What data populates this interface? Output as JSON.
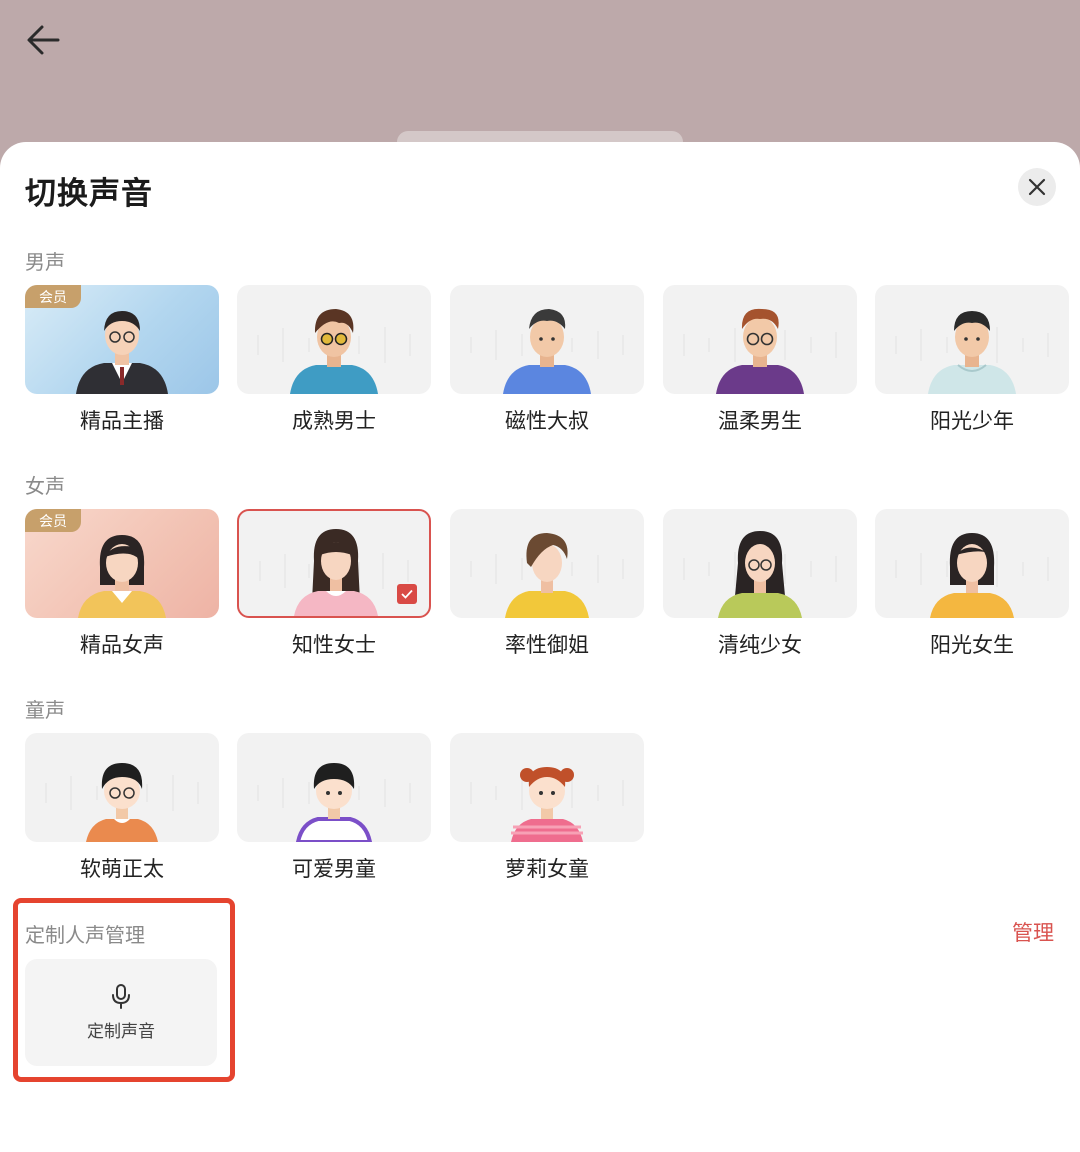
{
  "header": {
    "back_icon": "back-arrow-icon"
  },
  "sheet": {
    "title": "切换声音",
    "close_icon": "close-icon",
    "sections": {
      "male": {
        "label": "男声",
        "items": [
          {
            "label": "精品主播",
            "vip": "会员"
          },
          {
            "label": "成熟男士"
          },
          {
            "label": "磁性大叔"
          },
          {
            "label": "温柔男生"
          },
          {
            "label": "阳光少年"
          }
        ]
      },
      "female": {
        "label": "女声",
        "items": [
          {
            "label": "精品女声",
            "vip": "会员"
          },
          {
            "label": "知性女士",
            "selected": true
          },
          {
            "label": "率性御姐"
          },
          {
            "label": "清纯少女"
          },
          {
            "label": "阳光女生"
          }
        ]
      },
      "child": {
        "label": "童声",
        "items": [
          {
            "label": "软萌正太"
          },
          {
            "label": "可爱男童"
          },
          {
            "label": "萝莉女童"
          }
        ]
      }
    },
    "custom": {
      "label": "定制人声管理",
      "manage": "管理",
      "card_label": "定制声音",
      "mic_icon": "microphone-icon"
    }
  },
  "colors": {
    "accent": "#d9534f",
    "backdrop": "#bda9aa",
    "vip_badge": "#c7a06b",
    "highlight": "#e5442f"
  }
}
